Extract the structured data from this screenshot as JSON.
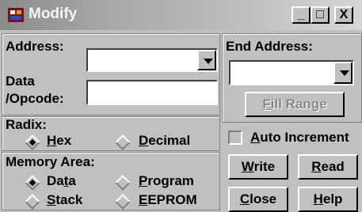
{
  "window": {
    "title": "Modify",
    "minimize_glyph": "_",
    "maximize_glyph": "□",
    "close_glyph": "X"
  },
  "address": {
    "label": "Address:",
    "value": ""
  },
  "data_opcode": {
    "label_line1": "Data",
    "label_line2": "/Opcode:",
    "value": ""
  },
  "radix": {
    "label": "Radix:",
    "options": [
      "Hex",
      "Decimal"
    ],
    "selected": "Hex"
  },
  "memory_area": {
    "label": "Memory Area:",
    "options": [
      "Data",
      "Program",
      "Stack",
      "EEPROM"
    ],
    "selected": "Data"
  },
  "end_address": {
    "label": "End Address:",
    "value": ""
  },
  "buttons": {
    "fill_range": "Fill Range",
    "write": "Write",
    "read": "Read",
    "close": "Close",
    "help": "Help"
  },
  "auto_increment": {
    "label": "Auto Increment",
    "checked": false
  },
  "icons": [
    "app-icon",
    "minimize-icon",
    "maximize-icon",
    "close-icon",
    "dropdown-arrow-icon"
  ]
}
